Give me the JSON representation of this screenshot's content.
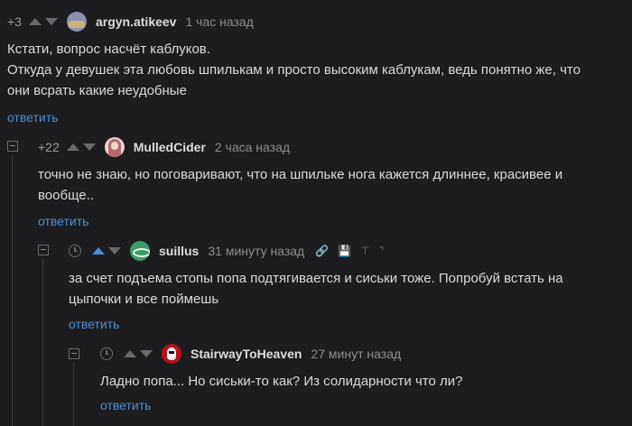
{
  "comments": [
    {
      "rating": "+3",
      "username": "argyn.atikeev",
      "time": "1 час назад",
      "text_lines": [
        "Кстати, вопрос насчёт каблуков.",
        "Откуда у девушек эта любовь шпилькам и просто высоким каблукам, ведь понятно же, что",
        "они всрать какие неудобные"
      ],
      "reply_label": "ответить"
    },
    {
      "rating": "+22",
      "username": "MulledCider",
      "time": "2 часа назад",
      "text_lines": [
        "точно не знаю, но поговаривают, что на шпильке нога кажется длиннее, красивее и",
        "вообще.."
      ],
      "reply_label": "ответить"
    },
    {
      "rating": "",
      "username": "suillus",
      "time": "31 минуту назад",
      "text_lines": [
        "за счет подъема стопы попа подтягивается и сиськи тоже. Попробуй встать на",
        "цыпочки и все поймешь"
      ],
      "reply_label": "ответить"
    },
    {
      "rating": "",
      "username": "StairwayToHeaven",
      "time": "27 минут назад",
      "text_lines": [
        "Ладно попа... Но сиськи-то как? Из солидарности что ли?"
      ],
      "reply_label": "ответить"
    }
  ],
  "toolbar_icons": [
    "link-icon",
    "save-icon",
    "jump-top-icon",
    "more-icon"
  ],
  "colors": {
    "background": "#1d1d1f",
    "link": "#4a8fd4",
    "upvote_active": "#4a8fd4"
  }
}
